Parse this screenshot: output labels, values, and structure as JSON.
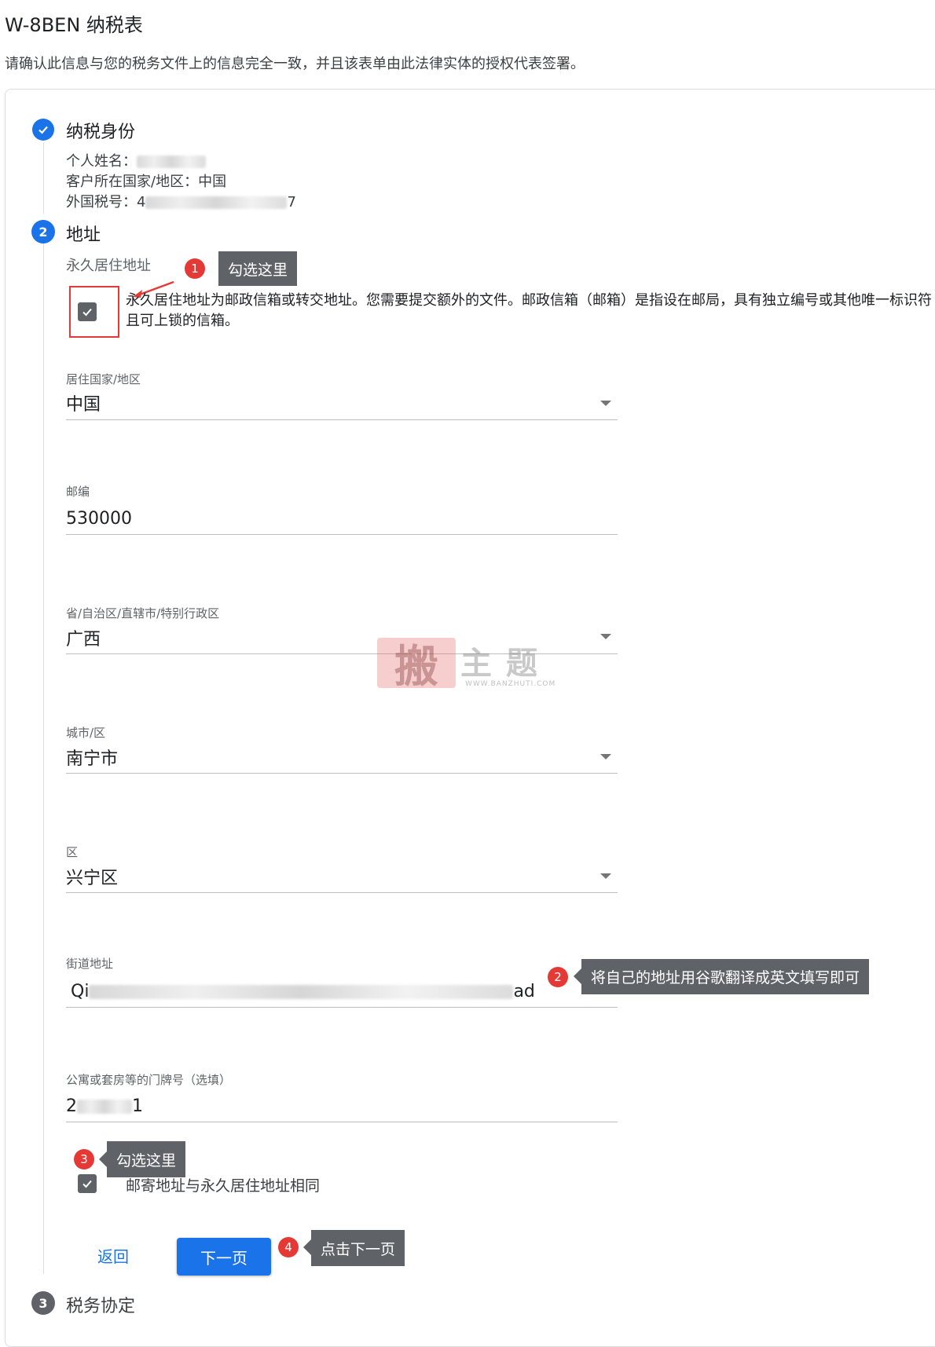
{
  "header": {
    "title": "W-8BEN 纳税表",
    "subtitle": "请确认此信息与您的税务文件上的信息完全一致，并且该表单由此法律实体的授权代表签署。"
  },
  "steps": {
    "step1": {
      "label": "纳税身份",
      "name_label": "个人姓名：",
      "country_line": "客户所在国家/地区：中国",
      "tax_id_label": "外国税号：",
      "tax_id_start": "4",
      "tax_id_end": "7"
    },
    "step2": {
      "number": "2",
      "label": "地址",
      "permanent_address_label": "永久居住地址",
      "po_box_note": "永久居住地址为邮政信箱或转交地址。您需要提交额外的文件。邮政信箱（邮箱）是指设在邮局，具有独立编号或其他唯一标识符且可上锁的信箱。",
      "po_box_checked": true,
      "fields": {
        "country": {
          "label": "居住国家/地区",
          "value": "中国"
        },
        "postcode": {
          "label": "邮编",
          "value": "530000"
        },
        "province": {
          "label": "省/自治区/直辖市/特别行政区",
          "value": "广西"
        },
        "city": {
          "label": "城市/区",
          "value": "南宁市"
        },
        "district": {
          "label": "区",
          "value": "兴宁区"
        },
        "street": {
          "label": "街道地址",
          "value_start": "Qi",
          "value_end": "ad"
        },
        "apartment": {
          "label": "公寓或套房等的门牌号（选填）",
          "value_start": "2",
          "value_end": "1"
        }
      },
      "mailing_same_label": "邮寄地址与永久居住地址相同",
      "mailing_same_checked": true,
      "back_label": "返回",
      "next_label": "下一页"
    },
    "step3": {
      "number": "3",
      "label": "税务协定"
    }
  },
  "annotations": {
    "a1": {
      "number": "1",
      "text": "勾选这里"
    },
    "a2": {
      "number": "2",
      "text": "将自己的地址用谷歌翻译成英文填写即可"
    },
    "a3": {
      "number": "3",
      "text": "勾选这里"
    },
    "a4": {
      "number": "4",
      "text": "点击下一页"
    }
  },
  "watermark": {
    "seal_char": "搬",
    "text": "主题",
    "url": "WWW.BANZHUTI.COM"
  },
  "colors": {
    "primary": "#1a73e8",
    "annotation_red": "#e53935",
    "tooltip_gray": "#5f6368",
    "step3_gray": "#5f6368"
  }
}
